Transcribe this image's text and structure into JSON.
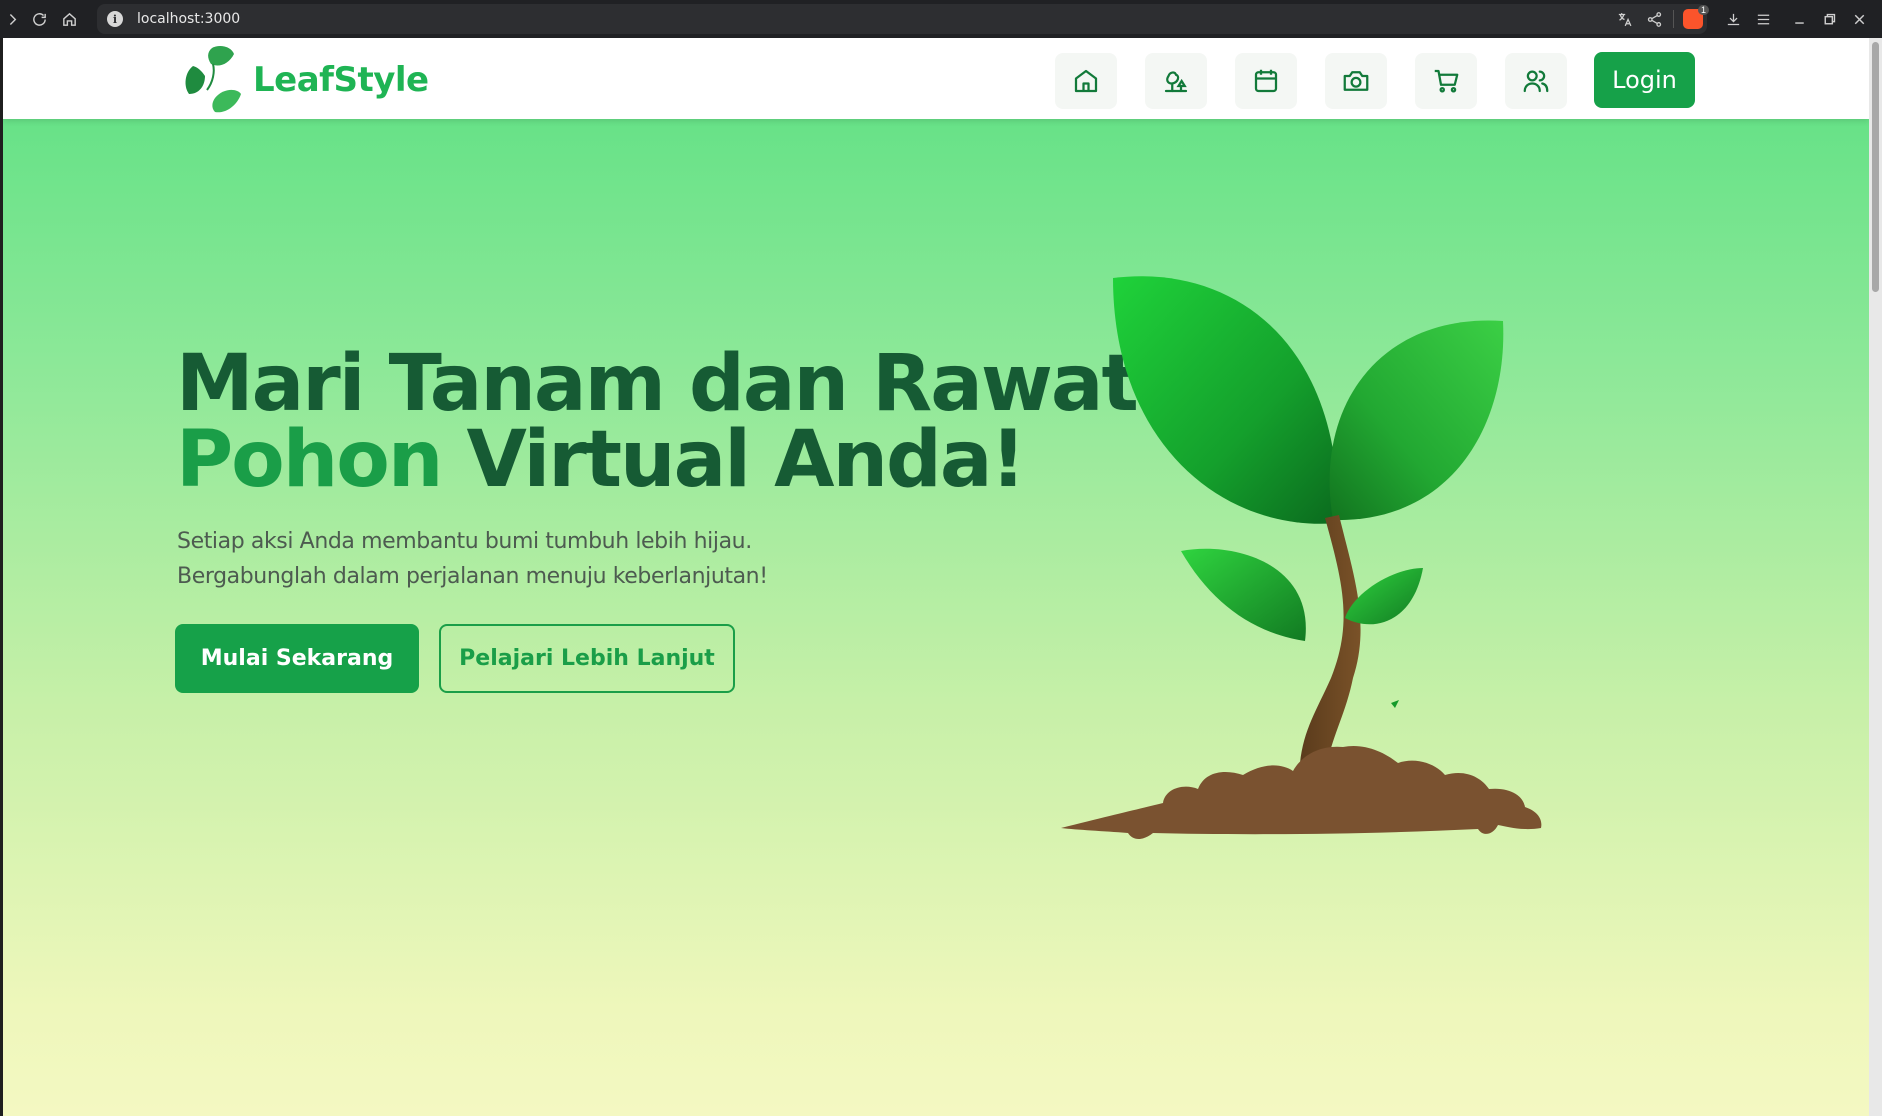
{
  "browser": {
    "url": "localhost:3000",
    "extension_badge": "1"
  },
  "header": {
    "logo_text": "LeafStyle",
    "nav_icons": [
      "home-icon",
      "trees-icon",
      "calendar-icon",
      "camera-icon",
      "cart-icon",
      "users-icon"
    ],
    "login_label": "Login"
  },
  "hero": {
    "title_line1": "Mari Tanam dan Rawat",
    "title_accent": "Pohon",
    "title_line2_rest": " Virtual Anda!",
    "subtitle_line1": "Setiap aksi Anda membantu bumi tumbuh lebih hijau.",
    "subtitle_line2": "Bergabunglah dalam perjalanan menuju keberlanjutan!",
    "primary_button": "Mulai Sekarang",
    "secondary_button": "Pelajari Lebih Lanjut"
  },
  "colors": {
    "brand_green": "#16a149",
    "title_dark_green": "#165b34",
    "accent_green": "#1a9e48"
  }
}
